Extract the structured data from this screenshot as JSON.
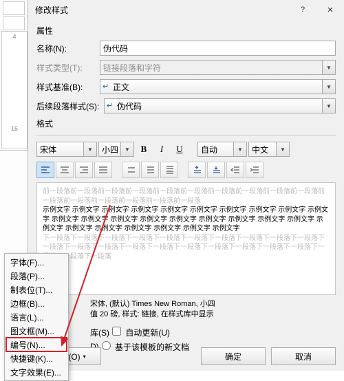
{
  "dialog": {
    "title": "修改样式"
  },
  "section_props": "属性",
  "section_format": "格式",
  "rows": {
    "name_label": "名称(N):",
    "name_value": "伪代码",
    "type_label": "样式类型(T):",
    "type_value": "链接段落和字符",
    "based_label": "样式基准(B):",
    "based_value": "正文",
    "follow_label": "后续段落样式(S):",
    "follow_value": "伪代码"
  },
  "fontbar": {
    "font": "宋体",
    "size": "小四",
    "b": "B",
    "i": "I",
    "u": "U",
    "color": "自动",
    "lang": "中文"
  },
  "preview": {
    "ghost_before": "前一段落前一段落前一段落前一段落前一段落前一段落前一段落前一段落前一段落前一段落前一段落前一段落前一段落前一段落前一段落前一段落",
    "sample": "示例文字 示例文字 示例文字 示例文字 示例文字 示例文字 示例文字 示例文字 示例文字 示例文字 示例文字 示例文字 示例文字 示例文字 示例文字 示例文字 示例文字 示例文字 示例文字 示例文字 示例文字 示例文字 示例文字 示例文字 示例文字 示例文字",
    "ghost_after": "下一段落下一段落下一段落下一段落下一段落下一段落下一段落下一段落下一段落下一段落下一段落下一段落下一段落下一段落下一段落下一段落下一段落下一段落下一段落下一段落下一段落下一段落下一段落"
  },
  "desc": {
    "line1": "宋体, (默认) Times New Roman, 小四",
    "line2": "值 20 磅, 样式: 链接, 在样式库中显示"
  },
  "opts": {
    "addlib": "库(S)",
    "autoupd": "自动更新(U)",
    "inthis": "D)",
    "templ": "基于该模板的新文档"
  },
  "buttons": {
    "format": "格式(O)",
    "ok": "确定",
    "cancel": "取消"
  },
  "menu": {
    "font": "字体(F)...",
    "para": "段落(P)...",
    "tabs": "制表位(T)...",
    "border": "边框(B)...",
    "lang": "语言(L)...",
    "frame": "图文框(M)...",
    "numbering": "编号(N)...",
    "shortcut": "快捷键(K)...",
    "texteffect": "文字效果(E)..."
  },
  "ruler": {
    "a": "4",
    "b": "16"
  },
  "glyph": {
    "para": "↵",
    "dd": "▾",
    "help": "?",
    "close": "✕",
    "arrow": "▼"
  }
}
